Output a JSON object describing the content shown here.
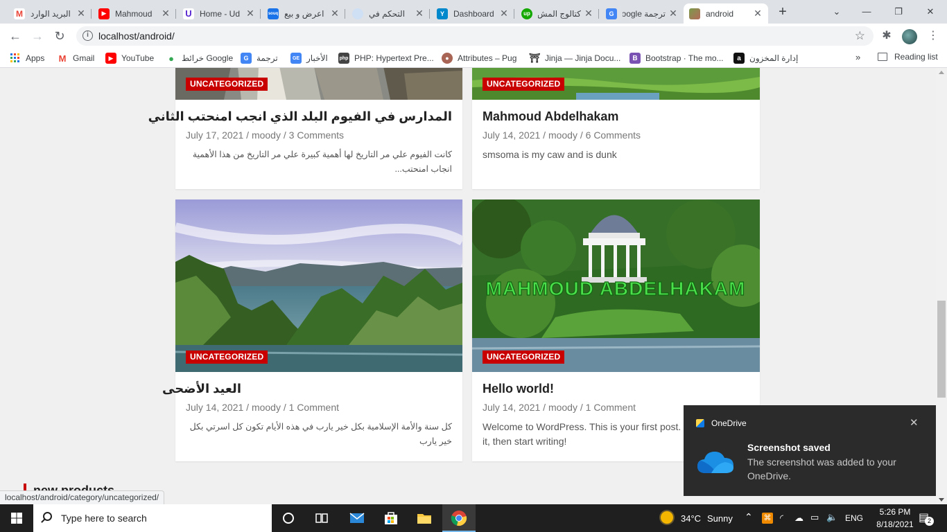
{
  "tabs": [
    {
      "title": "البريد الوارد",
      "favicon": "gmail-icon",
      "color": "#ffffff"
    },
    {
      "title": "Mahmoud",
      "favicon": "youtube-icon",
      "color": "#ff0000"
    },
    {
      "title": "Home - Ud",
      "favicon": "udemy-icon",
      "color": "#5624d0"
    },
    {
      "title": "اعرض و بيع",
      "favicon": "souq-icon",
      "color": "#1a73e8"
    },
    {
      "title": "التحكم في",
      "favicon": "cloud-icon",
      "color": "#4a90d9"
    },
    {
      "title": "Dashboard",
      "favicon": "dashboard-icon",
      "color": "#0088cc"
    },
    {
      "title": "كتالوج المش",
      "favicon": "upwork-icon",
      "color": "#14a800"
    },
    {
      "title": "ترجمة Google",
      "favicon": "google-translate-icon",
      "color": "#4285f4"
    },
    {
      "title": "android",
      "favicon": "site-icon",
      "color": "#7b9a4b"
    }
  ],
  "toolbar": {
    "url": "localhost/android/"
  },
  "bookmarks": [
    {
      "label": "Apps",
      "icon": "apps-grid-icon",
      "color": "#4285f4"
    },
    {
      "label": "Gmail",
      "icon": "gmail-icon",
      "color": "#ea4335"
    },
    {
      "label": "YouTube",
      "icon": "youtube-icon",
      "color": "#ff0000"
    },
    {
      "label": "خرائط Google",
      "icon": "maps-pin-icon",
      "color": "#34a853"
    },
    {
      "label": "ترجمة",
      "icon": "google-translate-icon",
      "color": "#4285f4"
    },
    {
      "label": "الأخبار",
      "icon": "news-icon",
      "color": "#4285f4"
    },
    {
      "label": "PHP: Hypertext Pre...",
      "icon": "php-icon",
      "color": "#444444"
    },
    {
      "label": "Attributes – Pug",
      "icon": "pug-icon",
      "color": "#a86454"
    },
    {
      "label": "Jinja — Jinja Docu...",
      "icon": "jinja-icon",
      "color": "#333333"
    },
    {
      "label": "Bootstrap · The mo...",
      "icon": "bootstrap-icon",
      "color": "#7952b3"
    },
    {
      "label": "إدارة المخزون",
      "icon": "amazon-icon",
      "color": "#111111"
    }
  ],
  "reading_list": "Reading list",
  "posts": [
    {
      "category": "UNCATEGORIZED",
      "title": "المدارس في الفيوم البلد الذي انجب امنحتب الثاني",
      "meta": "July 17, 2021 / moody / 3 Comments",
      "excerpt": "كانت الفيوم علي مر التاريخ لها أهمية كبيرة علي مر التاريخ من هذا الأهمية انجاب امنحتب..."
    },
    {
      "category": "UNCATEGORIZED",
      "title": "Mahmoud Abdelhakam",
      "meta": "July 14, 2021 / moody / 6 Comments",
      "excerpt": "smsoma is my caw and is dunk"
    },
    {
      "category": "UNCATEGORIZED",
      "title": "العيد الأضحى",
      "meta": "July 14, 2021 / moody / 1 Comment",
      "excerpt": "كل سنة والأمة الإسلامية بكل خير يارب في هذه الأيام تكون كل اسرتي بكل خير يارب"
    },
    {
      "category": "UNCATEGORIZED",
      "title": "Hello world!",
      "meta": "July 14, 2021 / moody / 1 Comment",
      "excerpt": "Welcome to WordPress. This is your first post. Edit or delete it, then start writing!",
      "image_text": "MAHMOUD ABDELHAKAM"
    }
  ],
  "section_heading": "new products",
  "status_url": "localhost/android/category/uncategorized/",
  "toast": {
    "app": "OneDrive",
    "title": "Screenshot saved",
    "message": "The screenshot was added to your OneDrive."
  },
  "taskbar": {
    "search_placeholder": "Type here to search",
    "weather_temp": "34°C",
    "weather_desc": "Sunny",
    "language": "ENG",
    "time": "5:26 PM",
    "date": "8/18/2021",
    "notifications": "2"
  },
  "colors": {
    "accent_red": "#c90000",
    "tab_bg": "#dee1e6",
    "taskbar": "#1f1f1f"
  }
}
